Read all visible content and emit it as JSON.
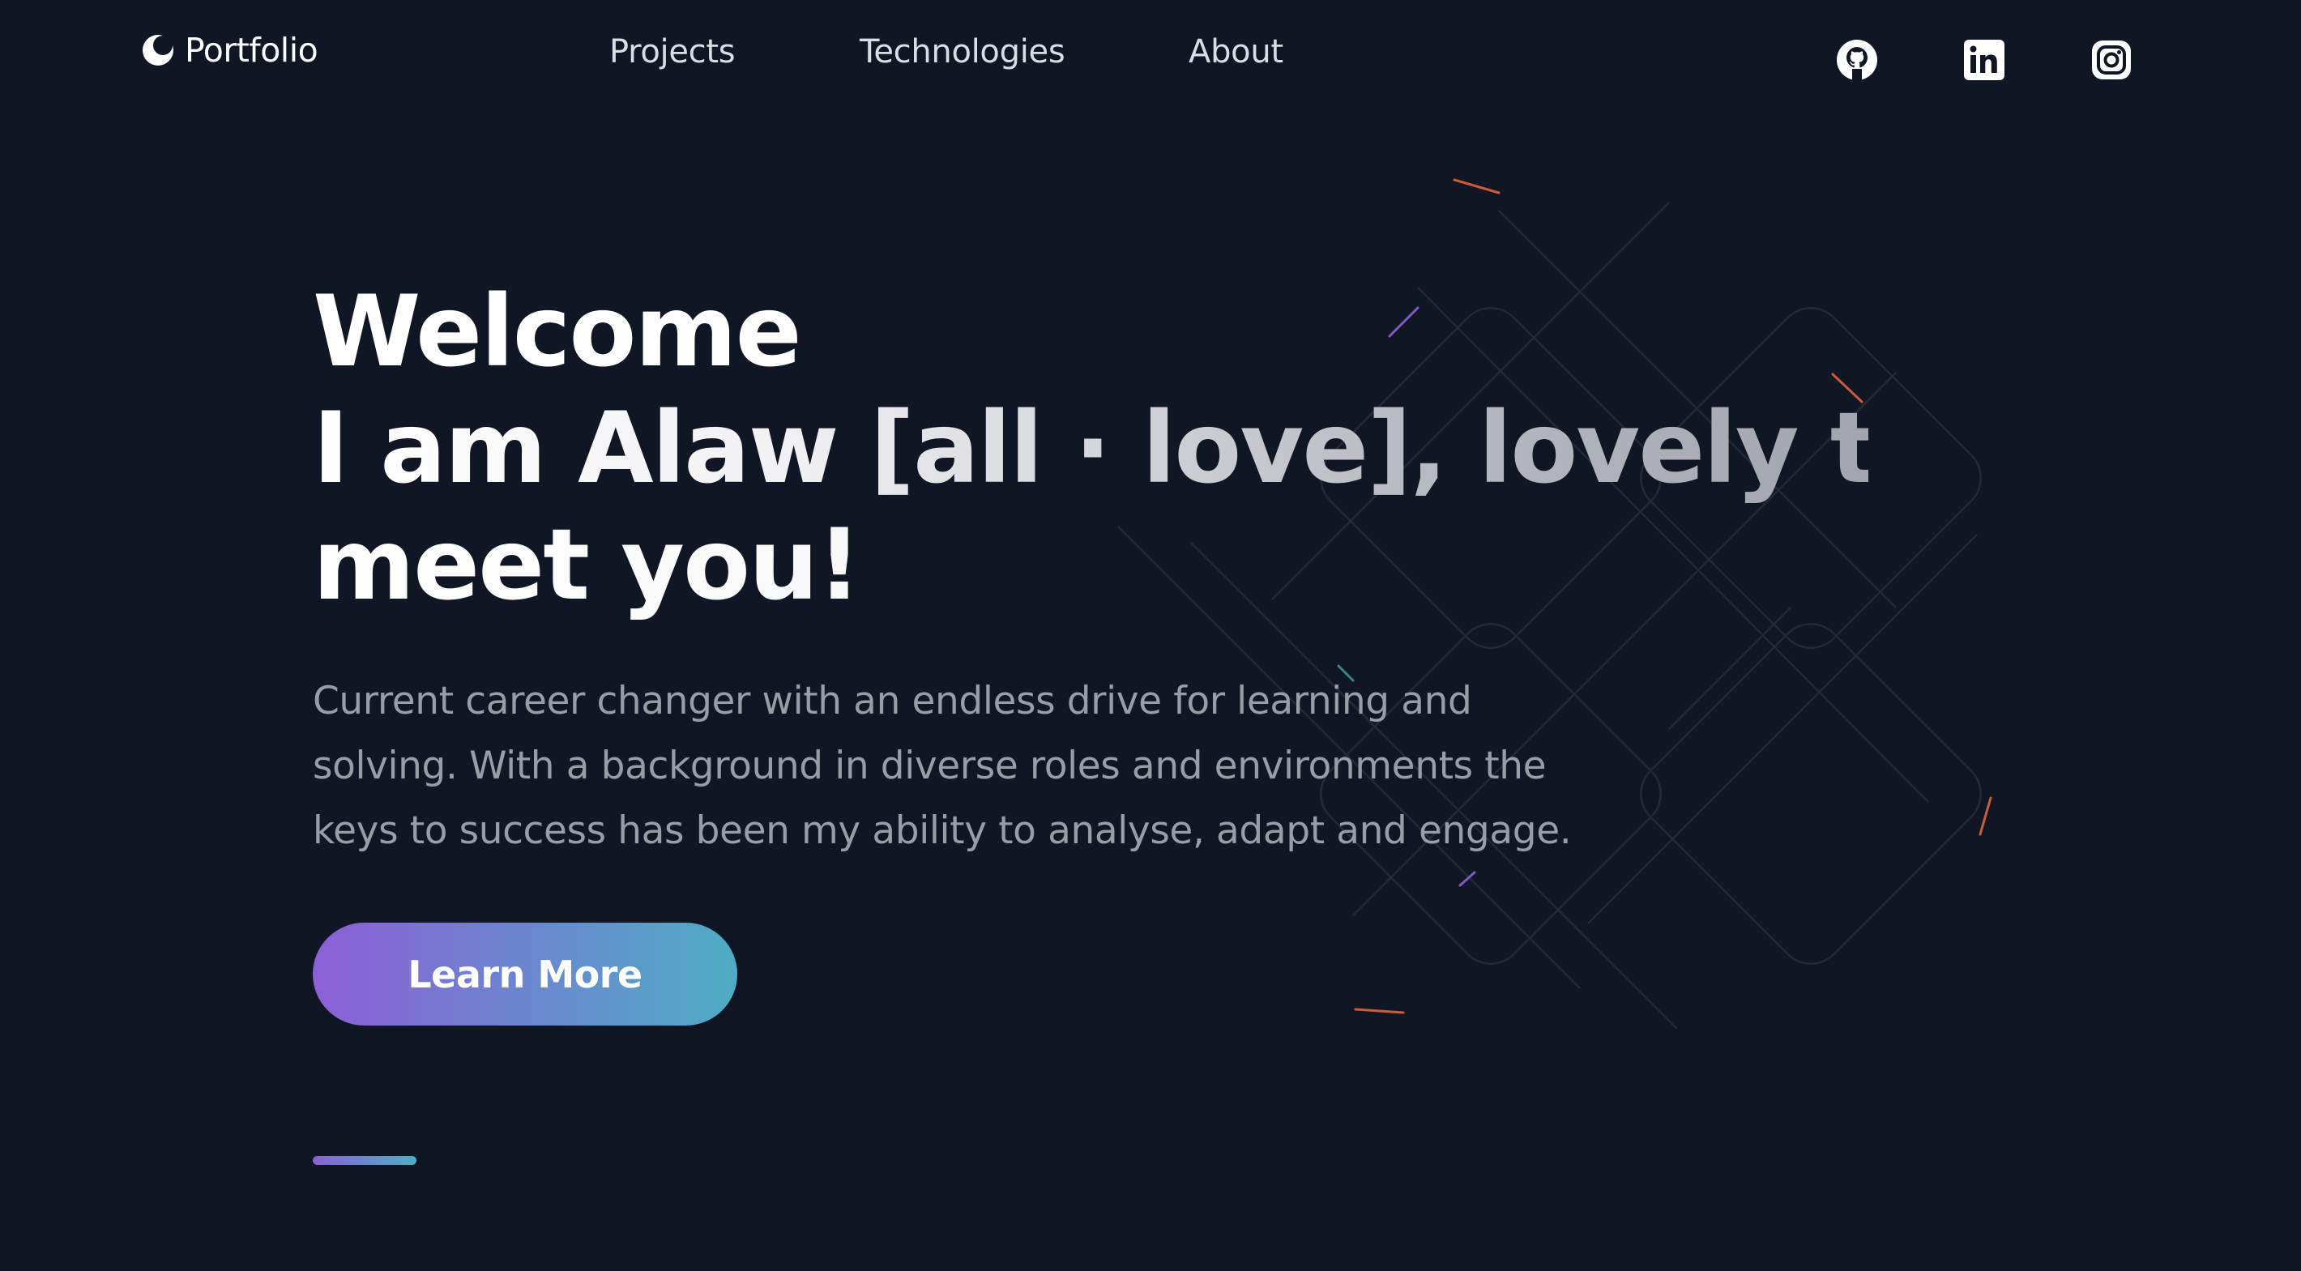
{
  "nav": {
    "logo_text": "Portfolio",
    "logo_icon": "crescent-logo-icon",
    "links": [
      {
        "label": "Projects"
      },
      {
        "label": "Technologies"
      },
      {
        "label": "About"
      }
    ],
    "social": [
      {
        "icon": "github-icon"
      },
      {
        "icon": "linkedin-icon"
      },
      {
        "icon": "instagram-icon"
      }
    ]
  },
  "hero": {
    "title_line1": "Welcome",
    "title_line2": "I am Alaw [all · love], lovely to",
    "title_line3": "meet you!",
    "description": "Current career changer with an endless drive for learning and solving. With a background in diverse roles and environments the keys to success has been my ability to analyse, adapt and engage.",
    "cta_label": "Learn More"
  },
  "colors": {
    "background": "#111624",
    "gradient_start": "#8d5fd6",
    "gradient_end": "#4fadc4",
    "text_primary": "#ffffff",
    "text_muted": "#9a9ca6",
    "meteor_orange": "#e2643c",
    "meteor_purple": "#8a63d4",
    "meteor_teal": "#3fb7b4"
  }
}
